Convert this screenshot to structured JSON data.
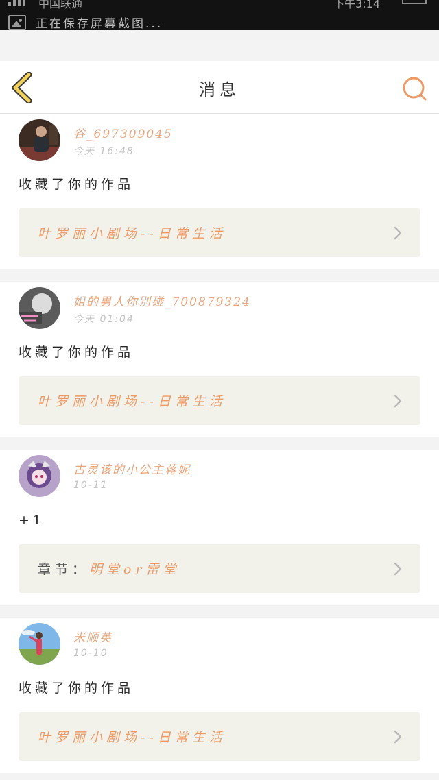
{
  "status_bar": {
    "carrier": "中国联通",
    "time": "下午3:14",
    "notification": "正在保存屏幕截图..."
  },
  "nav": {
    "title": "消息"
  },
  "colors": {
    "accent": "#ec9a66",
    "back_icon": "#f2d15a",
    "card_link_bg": "#f3f2ea"
  },
  "messages": [
    {
      "username": "谷_697309045",
      "time": "今天 16:48",
      "text": "收藏了你的作品",
      "link_prefix": "",
      "link": "叶罗丽小剧场--日常生活"
    },
    {
      "username": "姐的男人你别碰_700879324",
      "time": "今天 01:04",
      "text": "收藏了你的作品",
      "link_prefix": "",
      "link": "叶罗丽小剧场--日常生活"
    },
    {
      "username": "古灵该的小公主蒋妮",
      "time": "10-11",
      "text": "+1",
      "link_prefix": "章节：",
      "link": "明堂or雷堂"
    },
    {
      "username": "米顺英",
      "time": "10-10",
      "text": "收藏了你的作品",
      "link_prefix": "",
      "link": "叶罗丽小剧场--日常生活"
    }
  ]
}
